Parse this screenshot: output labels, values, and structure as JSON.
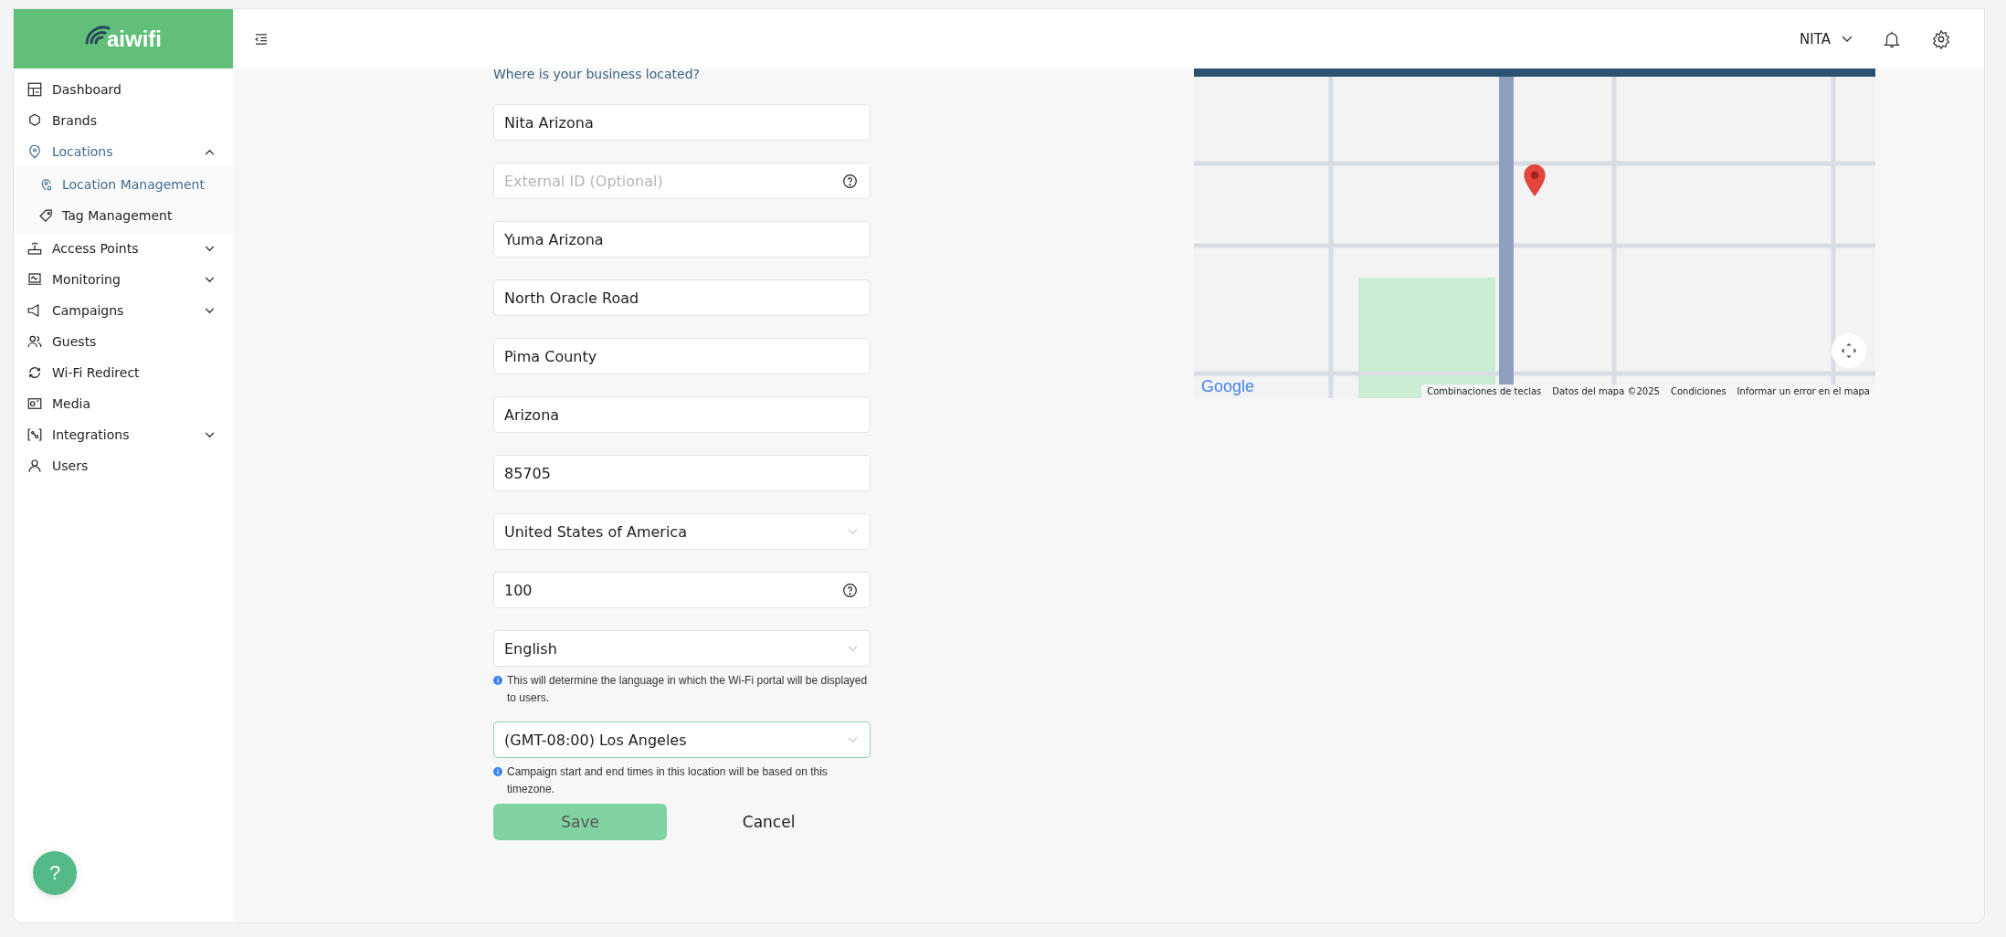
{
  "brand": {
    "name": "aiwifi"
  },
  "sidebar": {
    "items": [
      {
        "label": "Dashboard",
        "kind": "link",
        "selected": false
      },
      {
        "label": "Brands",
        "kind": "link",
        "selected": false
      },
      {
        "label": "Locations",
        "kind": "group",
        "selected": true,
        "expanded": true,
        "children": [
          {
            "label": "Location Management",
            "selected": true
          },
          {
            "label": "Tag Management",
            "selected": false
          }
        ]
      },
      {
        "label": "Access Points",
        "kind": "group",
        "selected": false,
        "expanded": false
      },
      {
        "label": "Monitoring",
        "kind": "group",
        "selected": false,
        "expanded": false
      },
      {
        "label": "Campaigns",
        "kind": "group",
        "selected": false,
        "expanded": false
      },
      {
        "label": "Guests",
        "kind": "link",
        "selected": false
      },
      {
        "label": "Wi-Fi Redirect",
        "kind": "link",
        "selected": false
      },
      {
        "label": "Media",
        "kind": "link",
        "selected": false
      },
      {
        "label": "Integrations",
        "kind": "group",
        "selected": false,
        "expanded": false
      },
      {
        "label": "Users",
        "kind": "link",
        "selected": false
      }
    ]
  },
  "help_button": {
    "label": "?"
  },
  "topbar": {
    "user": "NITA"
  },
  "form": {
    "question": "Where is your business located?",
    "fields": [
      {
        "kind": "text",
        "value": "Nita Arizona",
        "focused": false
      },
      {
        "kind": "help",
        "placeholder": "External ID (Optional)",
        "focused": false
      },
      {
        "kind": "text",
        "value": "Yuma Arizona",
        "focused": false
      },
      {
        "kind": "text",
        "value": "North Oracle Road",
        "focused": false
      },
      {
        "kind": "text",
        "value": "Pima County",
        "focused": false
      },
      {
        "kind": "text",
        "value": "Arizona",
        "focused": false
      },
      {
        "kind": "text",
        "value": "85705",
        "focused": false
      },
      {
        "kind": "select",
        "value": "United States of America",
        "focused": false
      },
      {
        "kind": "help",
        "value": "100",
        "focused": false
      },
      {
        "kind": "select",
        "value": "English",
        "focused": false,
        "hint": "This will determine the language in which the Wi-Fi portal will be displayed to users."
      },
      {
        "kind": "select",
        "value": "(GMT-08:00) Los Angeles",
        "focused": true,
        "hint": "Campaign start and end times in this location will be based on this timezone."
      }
    ],
    "buttons": [
      {
        "label": "Save",
        "kind": "primary"
      },
      {
        "label": "Cancel",
        "kind": "plain"
      }
    ]
  },
  "map": {
    "logo": "Google",
    "attribution": [
      "Combinaciones de teclas",
      "Datos del mapa ©2025",
      "Condiciones",
      "Informar un error en el mapa"
    ]
  }
}
